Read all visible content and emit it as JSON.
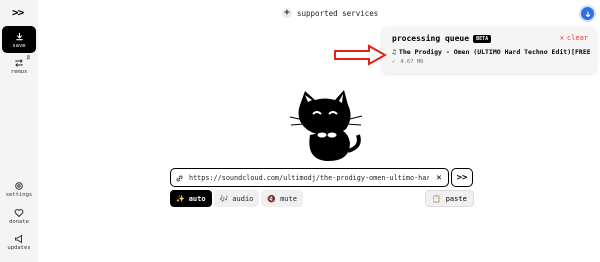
{
  "sidebar": {
    "logo": ">>",
    "items": [
      {
        "label": "save",
        "icon": "download-icon",
        "active": true
      },
      {
        "label": "remux",
        "icon": "repeat-icon",
        "badge": "β"
      },
      {
        "label": "settings",
        "icon": "gear-icon"
      },
      {
        "label": "donate",
        "icon": "heart-icon"
      },
      {
        "label": "updates",
        "icon": "megaphone-icon"
      }
    ]
  },
  "header": {
    "supported_services": "supported services"
  },
  "queue": {
    "title": "processing queue",
    "beta": "BETA",
    "clear": "clear",
    "item_title": "The Prodigy - Omen (ULTIMO Hard Techno Edit)[FREE …",
    "item_size": "4.67 MB"
  },
  "input": {
    "url": "https://soundcloud.com/ultimodj/the-prodigy-omen-ultimo-hard-",
    "go_label": ">>"
  },
  "modes": [
    {
      "label": "auto",
      "active": true
    },
    {
      "label": "audio",
      "active": false
    },
    {
      "label": "mute",
      "active": false
    }
  ],
  "paste": "paste",
  "colors": {
    "accent": "#2f6fe4",
    "danger": "#e23b3b",
    "arrow": "#e0241c"
  }
}
